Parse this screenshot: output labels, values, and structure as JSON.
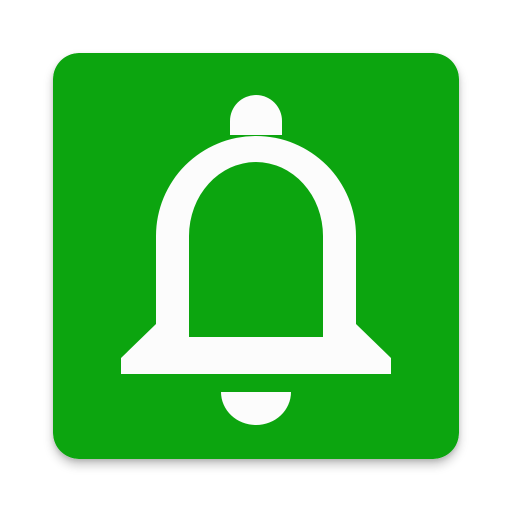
{
  "icon": {
    "name": "bell-icon",
    "background_color": "#0ca50f",
    "glyph_color": "#fcfcfc"
  }
}
